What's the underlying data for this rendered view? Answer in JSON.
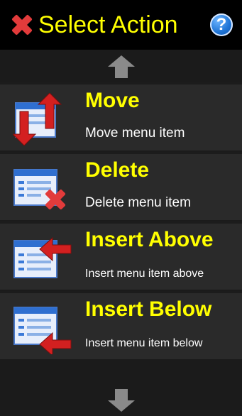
{
  "header": {
    "title": "Select Action",
    "help_glyph": "?"
  },
  "actions": [
    {
      "label": "Move",
      "description": "Move menu item",
      "icon": "move-icon"
    },
    {
      "label": "Delete",
      "description": "Delete menu item",
      "icon": "delete-icon"
    },
    {
      "label": "Insert Above",
      "description": "Insert menu item above",
      "icon": "insert-above-icon"
    },
    {
      "label": "Insert Below",
      "description": "Insert menu item below",
      "icon": "insert-below-icon"
    }
  ],
  "colors": {
    "title": "#ffff00",
    "background": "#1b1b1b",
    "item_background": "#2a2a2a",
    "accent_red": "#d32020",
    "help_blue": "#1e74d6"
  }
}
